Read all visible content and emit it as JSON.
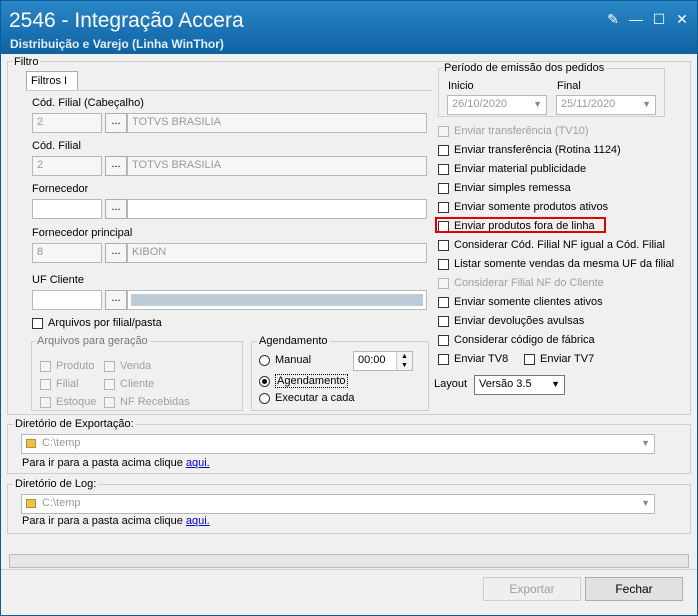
{
  "window": {
    "title": "2546 - Integração Accera",
    "subtitle": "Distribuição e Varejo (Linha WinThor)"
  },
  "filtro": {
    "group_title": "Filtro",
    "tab": "Filtros I",
    "cod_filial_cab": {
      "label": "Cód. Filial (Cabeçalho)",
      "code": "2",
      "name": "TOTVS BRASILIA"
    },
    "cod_filial": {
      "label": "Cód. Filial",
      "code": "2",
      "name": "TOTVS BRASILIA"
    },
    "fornecedor": {
      "label": "Fornecedor",
      "code": "",
      "name": ""
    },
    "fornecedor_principal": {
      "label": "Fornecedor principal",
      "code": "8",
      "name": "KIBON"
    },
    "uf_cliente": {
      "label": "UF Cliente",
      "code": "",
      "name": ""
    },
    "dots": "...",
    "arquivos_filial": "Arquivos por filial/pasta"
  },
  "arquivos_geracao": {
    "title": "Arquivos para geração",
    "items": [
      "Produto",
      "Venda",
      "Filial",
      "Cliente",
      "Estoque",
      "NF Recebidas"
    ]
  },
  "agendamento": {
    "title": "Agendamento",
    "manual": "Manual",
    "time": "00:00",
    "agendamento": "Agendamento",
    "executar": "Executar a cada"
  },
  "periodo": {
    "title": "Período de emissão dos pedidos",
    "inicio_label": "Inicio",
    "inicio": "26/10/2020",
    "final_label": "Final",
    "final": "25/11/2020"
  },
  "options": [
    {
      "label": "Enviar transferência (TV10)",
      "disabled": true
    },
    {
      "label": "Enviar transferência (Rotina 1124)",
      "disabled": false
    },
    {
      "label": "Enviar material publicidade",
      "disabled": false
    },
    {
      "label": "Enviar simples remessa",
      "disabled": false
    },
    {
      "label": "Enviar somente produtos ativos",
      "disabled": false
    },
    {
      "label": "Enviar produtos fora de linha",
      "disabled": false
    },
    {
      "label": "Considerar Cód. Filial NF igual a Cód. Filial",
      "disabled": false
    },
    {
      "label": "Listar somente vendas da mesma UF da filial",
      "disabled": false
    },
    {
      "label": "Considerar Filial NF do Cliente",
      "disabled": true
    },
    {
      "label": "Enviar somente clientes ativos",
      "disabled": false
    },
    {
      "label": "Enviar devoluções avulsas",
      "disabled": false
    },
    {
      "label": "Considerar código de fábrica",
      "disabled": false
    }
  ],
  "tv8": "Enviar TV8",
  "tv7": "Enviar TV7",
  "layout": {
    "label": "Layout",
    "value": "Versão 3.5"
  },
  "diretorio_exportacao": {
    "title": "Diretório de Exportação:",
    "path": "C:\\temp",
    "hint": "Para ir para a pasta acima clique",
    "link": "aqui."
  },
  "diretorio_log": {
    "title": "Diretório de Log:",
    "path": "C:\\temp",
    "hint": "Para ir para a pasta acima clique",
    "link": "aqui."
  },
  "buttons": {
    "exportar": "Exportar",
    "fechar": "Fechar"
  },
  "colors": {
    "titlebar": "#1a6fad",
    "highlight": "#e00000"
  }
}
